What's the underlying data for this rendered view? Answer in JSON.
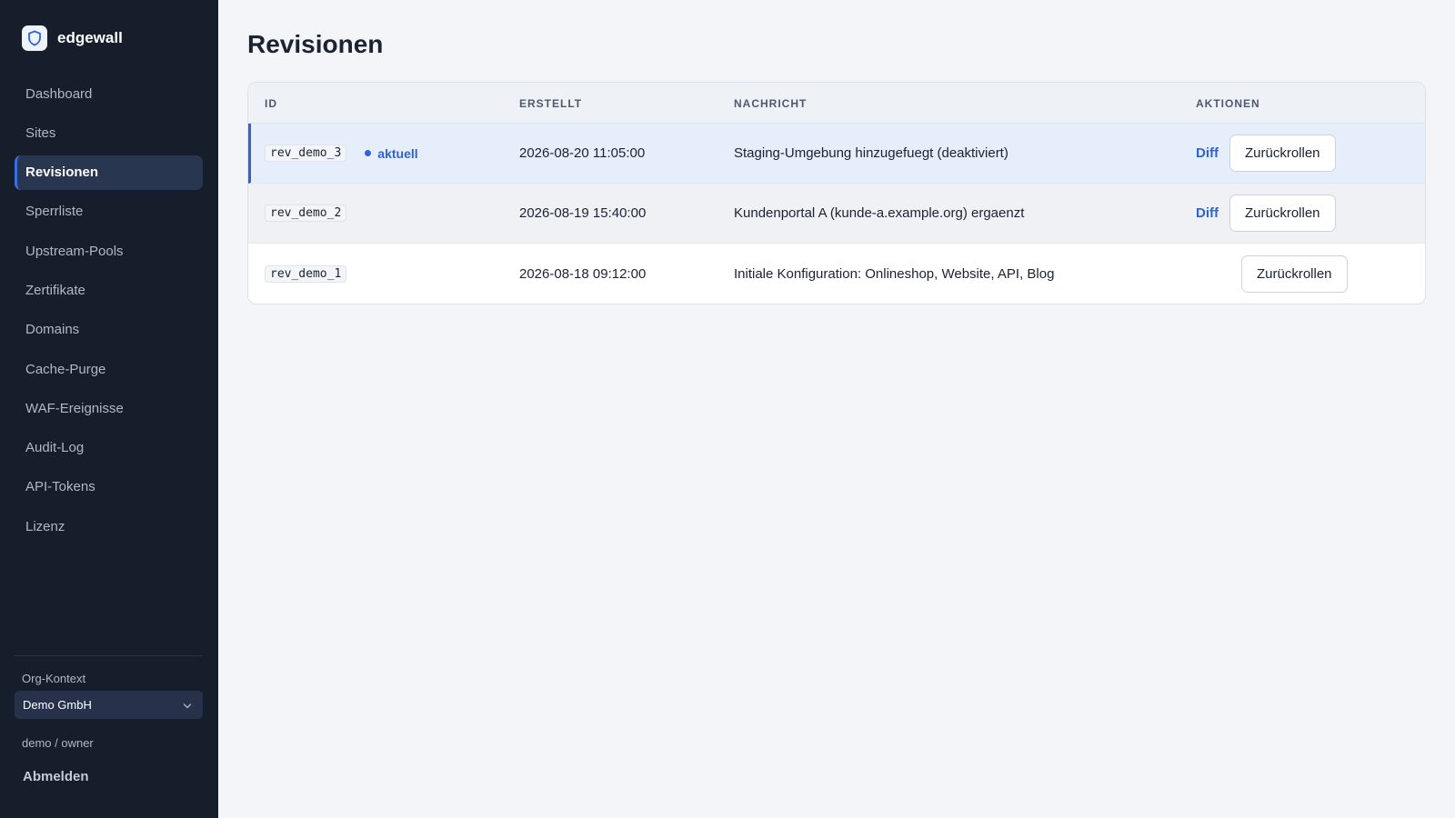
{
  "brand": {
    "name": "edgewall",
    "logo_icon": "shield-icon"
  },
  "sidebar": {
    "items": [
      {
        "label": "Dashboard",
        "active": false
      },
      {
        "label": "Sites",
        "active": false
      },
      {
        "label": "Revisionen",
        "active": true
      },
      {
        "label": "Sperrliste",
        "active": false
      },
      {
        "label": "Upstream-Pools",
        "active": false
      },
      {
        "label": "Zertifikate",
        "active": false
      },
      {
        "label": "Domains",
        "active": false
      },
      {
        "label": "Cache-Purge",
        "active": false
      },
      {
        "label": "WAF-Ereignisse",
        "active": false
      },
      {
        "label": "Audit-Log",
        "active": false
      },
      {
        "label": "API-Tokens",
        "active": false
      },
      {
        "label": "Lizenz",
        "active": false
      }
    ],
    "org_label": "Org-Kontext",
    "org_value": "Demo GmbH",
    "user": "demo / owner",
    "logout": "Abmelden"
  },
  "main": {
    "title": "Revisionen",
    "table": {
      "headers": {
        "id": "ID",
        "created": "ERSTELLT",
        "message": "NACHRICHT",
        "actions": "AKTIONEN"
      },
      "current_label": "aktuell",
      "diff_label": "Diff",
      "rollback_label": "Zurückrollen",
      "rows": [
        {
          "id": "rev_demo_3",
          "created": "2026-08-20 11:05:00",
          "message": "Staging-Umgebung hinzugefuegt (deaktiviert)",
          "current": true,
          "has_diff": true
        },
        {
          "id": "rev_demo_2",
          "created": "2026-08-19 15:40:00",
          "message": "Kundenportal A (kunde-a.example.org) ergaenzt",
          "current": false,
          "has_diff": true
        },
        {
          "id": "rev_demo_1",
          "created": "2026-08-18 09:12:00",
          "message": "Initiale Konfiguration: Onlineshop, Website, API, Blog",
          "current": false,
          "has_diff": false
        }
      ]
    }
  },
  "colors": {
    "sidebar_bg": "#161e2c",
    "accent": "#2f62d6",
    "page_bg": "#f3f5f9"
  }
}
